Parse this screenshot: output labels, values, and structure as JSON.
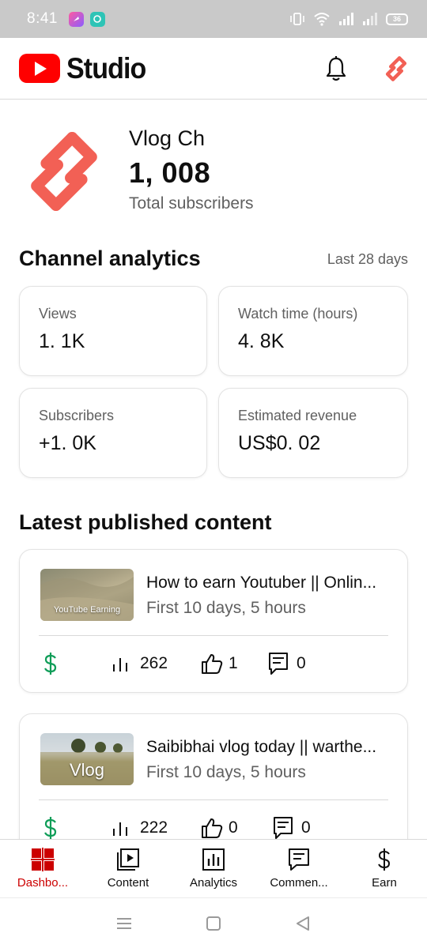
{
  "status_bar": {
    "time": "8:41",
    "battery": "36"
  },
  "app": {
    "title": "Studio",
    "colors": {
      "brand_red": "#ff0000",
      "accent_red": "#cc0000",
      "logo_coral": "#f26055",
      "money_green": "#0f9d58"
    }
  },
  "channel": {
    "name": "Vlog Ch",
    "subscribers": "1, 008",
    "subscribers_label": "Total subscribers"
  },
  "analytics": {
    "title": "Channel analytics",
    "period": "Last 28 days",
    "cards": [
      {
        "label": "Views",
        "value": "1. 1K"
      },
      {
        "label": "Watch time (hours)",
        "value": "4. 8K"
      },
      {
        "label": "Subscribers",
        "value": "+1. 0K"
      },
      {
        "label": "Estimated revenue",
        "value": "US$0. 02"
      }
    ]
  },
  "latest": {
    "title": "Latest published content",
    "videos": [
      {
        "title": "How to earn Youtuber || Onlin...",
        "subtitle": "First 10 days,  5 hours",
        "thumb_caption": "YouTube Earning",
        "views": "262",
        "likes": "1",
        "comments": "0"
      },
      {
        "title": "Saibibhai vlog today || warthe...",
        "subtitle": "First 10 days,  5 hours",
        "thumb_caption": "Vlog",
        "views": "222",
        "likes": "0",
        "comments": "0"
      }
    ]
  },
  "bottom_nav": [
    {
      "label": "Dashbo...",
      "icon": "dashboard-icon",
      "active": true
    },
    {
      "label": "Content",
      "icon": "content-icon",
      "active": false
    },
    {
      "label": "Analytics",
      "icon": "analytics-icon",
      "active": false
    },
    {
      "label": "Commen...",
      "icon": "comments-icon",
      "active": false
    },
    {
      "label": "Earn",
      "icon": "earn-icon",
      "active": false
    }
  ]
}
